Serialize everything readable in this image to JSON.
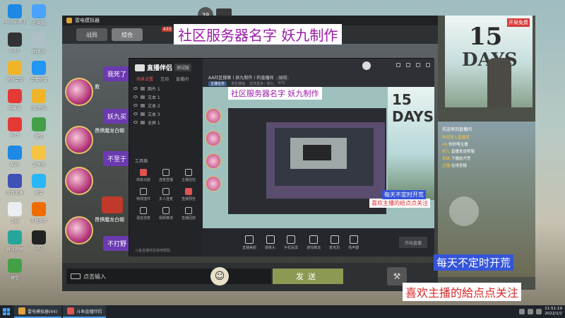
{
  "desktop": {
    "icons": [
      {
        "label": "Microsoft Edge",
        "color": "#1e88e5"
      },
      {
        "label": "此电脑",
        "color": "#4aa3ff"
      },
      {
        "label": "OBS",
        "color": "#333333"
      },
      {
        "label": "回收站",
        "color": "#b0bec5"
      },
      {
        "label": "腾讯会议",
        "color": "#f0b429"
      },
      {
        "label": "百度网盘",
        "color": "#2196f3"
      },
      {
        "label": "网易云",
        "color": "#e53935"
      },
      {
        "label": "QQ音乐",
        "color": "#f0b429"
      },
      {
        "label": "WPS",
        "color": "#e53935"
      },
      {
        "label": "微信",
        "color": "#43a047"
      },
      {
        "label": "酷狗",
        "color": "#1e88e5"
      },
      {
        "label": "文件夹",
        "color": "#f6c343"
      },
      {
        "label": "游戏加速",
        "color": "#3f51b5"
      },
      {
        "label": "迅雷",
        "color": "#29b6f6"
      },
      {
        "label": "文档",
        "color": "#eceff1"
      },
      {
        "label": "手机助手",
        "color": "#ef6c00"
      },
      {
        "label": "腾讯视频",
        "color": "#26a69a"
      },
      {
        "label": "QQ",
        "color": "#222222"
      },
      {
        "label": "微信",
        "color": "#43a047"
      }
    ]
  },
  "game": {
    "titlebar": "雷电模拟器",
    "tabs": [
      {
        "label": "战局"
      },
      {
        "label": "综合"
      }
    ],
    "tab_badge": "433",
    "top_counter": "39",
    "chat": [
      {
        "name": "救",
        "message": "我死了"
      },
      {
        "name": "救",
        "message": "妖九买"
      },
      {
        "name": "畏惧魔龙白帽",
        "message": ""
      },
      {
        "name": "",
        "message": "不至于"
      },
      {
        "name": "畏惧魔龙白帽",
        "message": ""
      },
      {
        "name": "",
        "message": "不打野"
      }
    ],
    "input_placeholder": "点击输入",
    "send_label": "发送",
    "emoji_icon": "☺",
    "tool_icon": "⚒"
  },
  "title_overlay": "社区服务器名字  妖九制作",
  "live": {
    "app_name": "直播伴侣",
    "version": "测试版",
    "tabs": [
      "场景设置",
      "互动",
      "直播间"
    ],
    "scenes": [
      "图片 1",
      "文本 1",
      "文本 2",
      "文本 3",
      "全屏 1"
    ],
    "room_title": "AA社区搜索丨妖九制作丨的直播间",
    "room_tag": "编辑",
    "meta": {
      "pill": "主播任务",
      "category": "求生游戏",
      "info": "文件显示：妖九",
      "viewers": "671"
    },
    "tools_title": "工具箱",
    "tools": [
      "高级功能",
      "连麦直播",
      "主播自检",
      "特效插件",
      "多人连麦",
      "直播预告",
      "语音连麦",
      "视频推流",
      "直播回放"
    ],
    "bottom_note": "斗鱼直播伴侣使用帮助",
    "bar_items": [
      "直播美颜",
      "摄像头",
      "手机投屏",
      "游戏推流",
      "麦克风",
      "扬声器"
    ],
    "start_label": "开始直播",
    "nested_title": "社区服务器名字 妖九制作",
    "nested_banner1": "每天不定时开荒",
    "nested_banner2": "喜欢主播的给点点关注",
    "nested_poster": "15 DAYS"
  },
  "phone": {
    "days_number": "15",
    "days_word": "DAYS",
    "badge": "开局免费",
    "live_label": "欢迎来到直播间",
    "messages": [
      {
        "name": "欢迎进入直播间",
        "text": ""
      },
      {
        "name": "A9:",
        "text": "你好啊主播"
      },
      {
        "name": "妖九:",
        "text": "直播发说明服"
      },
      {
        "name": "系统:",
        "text": "下播前开荒"
      },
      {
        "name": "主播:",
        "text": "在线答疑"
      }
    ]
  },
  "banners": {
    "blue": "每天不定时开荒",
    "white": "喜欢主播的給点点关注"
  },
  "taskbar": {
    "items": [
      {
        "label": "雷电模拟器(64)"
      },
      {
        "label": "斗鱼直播伴侣"
      }
    ],
    "time": "11:51:19",
    "date": "2022/1/2"
  }
}
